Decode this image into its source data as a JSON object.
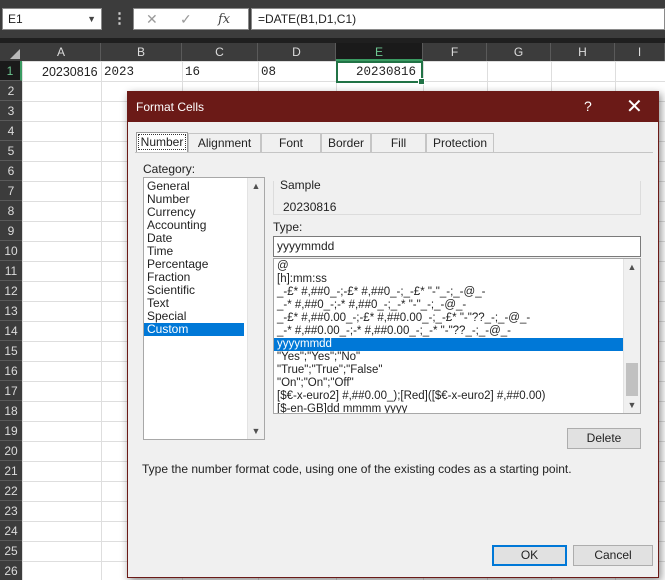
{
  "formula_bar": {
    "name_box": "E1",
    "name_box_arrow": "▼",
    "dots": "⋮",
    "cancel_glyph": "✕",
    "enter_glyph": "✓",
    "fx_label": "fx",
    "formula": "=DATE(B1,D1,C1)"
  },
  "columns": [
    "A",
    "B",
    "C",
    "D",
    "E",
    "F",
    "G",
    "H",
    "I"
  ],
  "rows": [
    "1",
    "2",
    "3",
    "4",
    "5",
    "6",
    "7",
    "8",
    "9",
    "10",
    "11",
    "12",
    "13",
    "14",
    "15",
    "16",
    "17",
    "18",
    "19",
    "20",
    "21",
    "22",
    "23",
    "24",
    "25",
    "26"
  ],
  "cells": {
    "A1": "20230816",
    "B1": "2023",
    "C1": "16",
    "D1": "08",
    "E1": "20230816"
  },
  "dialog": {
    "title": "Format Cells",
    "help": "?",
    "close": "✕",
    "tabs": [
      "Number",
      "Alignment",
      "Font",
      "Border",
      "Fill",
      "Protection"
    ],
    "active_tab": "Number",
    "category_label": "Category:",
    "categories": [
      "General",
      "Number",
      "Currency",
      "Accounting",
      "Date",
      "Time",
      "Percentage",
      "Fraction",
      "Scientific",
      "Text",
      "Special",
      "Custom"
    ],
    "selected_category": "Custom",
    "sample_label": "Sample",
    "sample_value": "20230816",
    "type_label": "Type:",
    "type_value": "yyyymmdd",
    "formats": [
      "@",
      "[h]:mm:ss",
      "_-£* #,##0_-;-£* #,##0_-;_-£* \"-\"_-;_-@_-",
      "_-* #,##0_-;-* #,##0_-;_-* \"-\"_-;_-@_-",
      "_-£* #,##0.00_-;-£* #,##0.00_-;_-£* \"-\"??_-;_-@_-",
      "_-* #,##0.00_-;-* #,##0.00_-;_-* \"-\"??_-;_-@_-",
      "yyyymmdd",
      "\"Yes\";\"Yes\";\"No\"",
      "\"True\";\"True\";\"False\"",
      "\"On\";\"On\";\"Off\"",
      "[$€-x-euro2] #,##0.00_);[Red]([$€-x-euro2] #,##0.00)",
      "[$-en-GB]dd mmmm yyyy"
    ],
    "selected_format": "yyyymmdd",
    "scroll_up": "▲",
    "scroll_down": "▼",
    "delete_button": "Delete",
    "hint": "Type the number format code, using one of the existing codes as a starting point.",
    "ok_button": "OK",
    "cancel_button": "Cancel"
  },
  "colors": {
    "title_bar": "#6b1a17",
    "selection": "#0078d7",
    "active_cell_border": "#217346"
  }
}
